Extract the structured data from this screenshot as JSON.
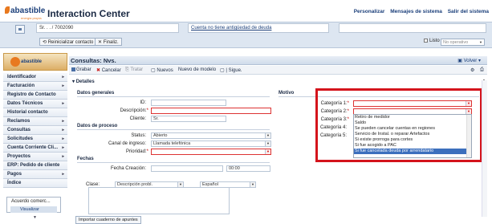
{
  "brand": {
    "logo_text": "abastible",
    "logo_sub": "energia propia",
    "app_title": "Interaction Center"
  },
  "top_links": [
    "Personalizar",
    "Mensajes de sistema",
    "Salir del sistema"
  ],
  "context": {
    "customer": "Sr. . . / 7002090",
    "message": "Cuenta no tiene antigüedad de deuda",
    "reset_label": "Reinicializar contacto",
    "finalize_label": "Finaliz.",
    "listo_label": "Listo",
    "status_value": "No operativo"
  },
  "sidebar": {
    "logo_text": "abastible",
    "items": [
      {
        "label": "Identificador",
        "arrow": "▸"
      },
      {
        "label": "Facturación",
        "arrow": "▸"
      },
      {
        "label": "Registro de Contacto",
        "arrow": ""
      },
      {
        "label": "Datos Técnicos",
        "arrow": "▸"
      },
      {
        "label": "Historial contacto",
        "arrow": ""
      },
      {
        "label": "Reclamos",
        "arrow": "▸"
      },
      {
        "label": "Consultas",
        "arrow": "▸"
      },
      {
        "label": "Solicitudes",
        "arrow": "▸"
      },
      {
        "label": "Cuenta Corriente Cli...",
        "arrow": "▸"
      },
      {
        "label": "Proyectos",
        "arrow": "▸"
      },
      {
        "label": "ERP: Pedido de cliente",
        "arrow": ""
      },
      {
        "label": "Pagos",
        "arrow": "▸"
      },
      {
        "label": "Índice",
        "arrow": ""
      }
    ],
    "agreement_title": "Acuerdo comerc...",
    "agreement_button": "Visualizar"
  },
  "main": {
    "title": "Consultas: Nvs.",
    "volver_label": "Volver",
    "toolbar": {
      "save": "Grabar",
      "cancel": "Cancelar",
      "process": "Tratar",
      "new": "Nuevos",
      "template": "Nuevo de modelo",
      "next": "Sigue."
    },
    "details_label": "Detalles",
    "general": {
      "heading": "Datos generales",
      "id_label": "ID:",
      "desc_label": "Descripción:",
      "client_label": "Cliente:",
      "client_value": "Sr."
    },
    "process": {
      "heading": "Datos de proceso",
      "status_label": "Status:",
      "status_value": "Abierto",
      "channel_label": "Canal de ingreso:",
      "channel_value": "Llamada telefónica",
      "priority_label": "Prioridad:"
    },
    "dates": {
      "heading": "Fechas",
      "created_label": "Fecha Creación:",
      "created_time": "00:00"
    },
    "text": {
      "class_label": "Clase:",
      "class_value": "Descripción probl.",
      "language_value": "Español"
    },
    "import_button": "Importar cuaderno de apuntes",
    "motivo": {
      "heading": "Motivo",
      "cat1": "Categoría 1:",
      "cat2": "Categoría 2:",
      "cat3": "Categoría 3:",
      "cat4": "Categoría 4:",
      "cat5": "Categoría 5:",
      "options": [
        "Retiro de medidor",
        "Saldo",
        "Se pueden cancelar cuentas en regiones",
        "Servicio de Instal. o reparar Artefactos",
        "Si existe prorroga para cortes",
        "Si fue acogido a PAC",
        "Si fue cancelada deuda por arrendatario"
      ],
      "selected_index": 6
    }
  },
  "colors": {
    "highlight": "#d4141c",
    "selection": "#3c6fbd",
    "brand": "#1b3f7a"
  }
}
